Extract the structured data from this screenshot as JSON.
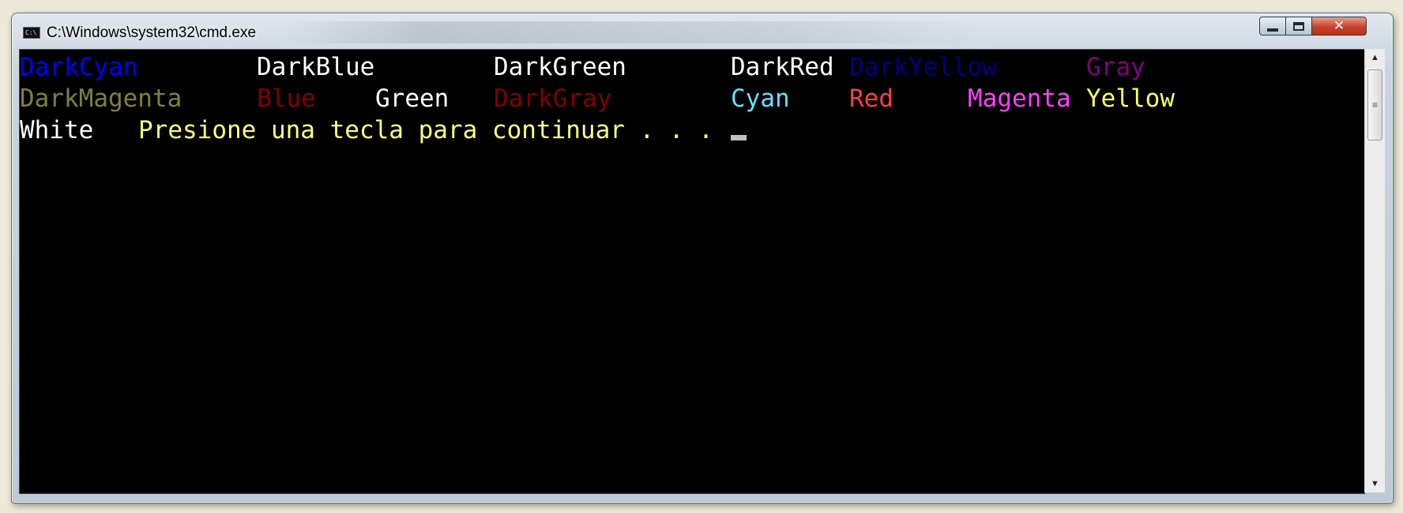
{
  "window": {
    "title": "C:\\Windows\\system32\\cmd.exe",
    "icon": "console-app-icon",
    "controls": {
      "minimize": "minimize-icon",
      "maximize": "maximize-icon",
      "close": "✕"
    }
  },
  "console": {
    "line1": [
      {
        "text": "DarkCyan",
        "color": "#0000ff"
      },
      {
        "text": "DarkBlue",
        "color": "#ffffff"
      },
      {
        "text": "DarkGreen",
        "color": "#ffffff"
      },
      {
        "text": "DarkRed",
        "color": "#ffffff"
      },
      {
        "text": "DarkYellow",
        "color": "#000080"
      },
      {
        "text": "Gray",
        "color": "#800080"
      }
    ],
    "line2": [
      {
        "text": "DarkMagenta",
        "color": "#808040"
      },
      {
        "text": "Blue",
        "color": "#800000"
      },
      {
        "text": "Green",
        "color": "#ffffff"
      },
      {
        "text": "DarkGray",
        "color": "#800000"
      },
      {
        "text": "Cyan",
        "color": "#66e0ff"
      },
      {
        "text": "Red",
        "color": "#ff4040"
      },
      {
        "text": "Magenta",
        "color": "#ff40ff"
      },
      {
        "text": "Yellow",
        "color": "#ffff60"
      }
    ],
    "line3": [
      {
        "text": "White",
        "color": "#ffffff"
      },
      {
        "text": "Presione una tecla para continuar . . .",
        "color": "#ffff80"
      }
    ],
    "cursor_color": "#c0c0c0"
  },
  "scrollbar": {
    "up": "▲",
    "down": "▼",
    "grip": "≡"
  }
}
